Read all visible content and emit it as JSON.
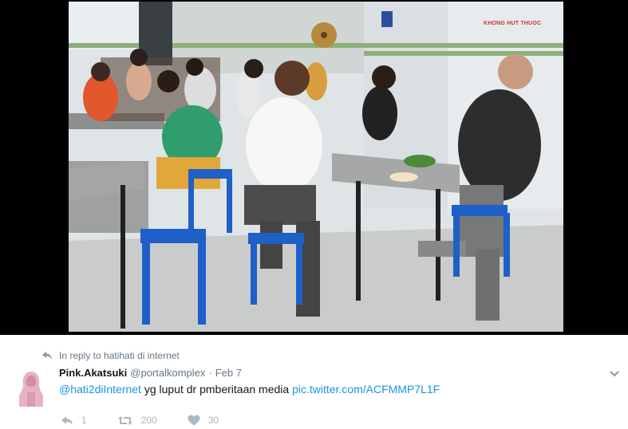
{
  "photo": {
    "sign_text": "KHONG HUT THUOC",
    "description_icon": "photo"
  },
  "tweet": {
    "reply_context": "In reply to hatihati di internet",
    "author_name": "Pink.Akatsuki",
    "author_handle": "@portalkomplex",
    "separator": "·",
    "date": "Feb 7",
    "mention": "@hati2diInternet",
    "text": "yg luput dr pmberitaan media",
    "link": "pic.twitter.com/ACFMMP7L1F",
    "actions": {
      "reply_count": "1",
      "retweet_count": "200",
      "like_count": "30"
    }
  },
  "colors": {
    "link": "#1b95e0",
    "muted": "#657786",
    "action": "#aab8c2",
    "stool": "#1f5fc8"
  }
}
